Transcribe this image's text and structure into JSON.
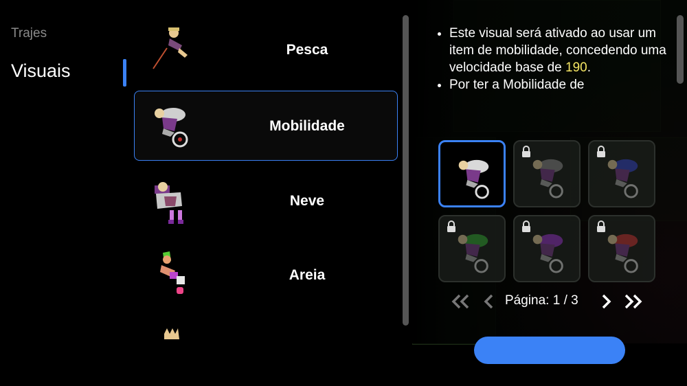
{
  "sidebar": {
    "heading": "Trajes",
    "items": [
      {
        "label": "Visuais",
        "selected": true
      }
    ]
  },
  "outfits": [
    {
      "label": "Pesca",
      "selected": false,
      "icon": "fishing-character-icon"
    },
    {
      "label": "Mobilidade",
      "selected": true,
      "icon": "bike-character-icon"
    },
    {
      "label": "Neve",
      "selected": false,
      "icon": "snow-character-icon"
    },
    {
      "label": "Areia",
      "selected": false,
      "icon": "sand-character-icon"
    },
    {
      "label": "",
      "selected": false,
      "icon": "partial-character-icon"
    }
  ],
  "description": {
    "line1_part1": "Este visual será ativado ao usar um item de mobilidade, concedendo uma velocidade base de ",
    "speed": "190",
    "line1_part2": ".",
    "line2": "Por ter a Mobilidade de"
  },
  "variants": [
    {
      "locked": false,
      "selected": true,
      "accent": "#d9d9d9"
    },
    {
      "locked": true,
      "selected": false,
      "accent": "#8a8a8a"
    },
    {
      "locked": true,
      "selected": false,
      "accent": "#3344cc"
    },
    {
      "locked": true,
      "selected": false,
      "accent": "#33aa33"
    },
    {
      "locked": true,
      "selected": false,
      "accent": "#9933cc"
    },
    {
      "locked": true,
      "selected": false,
      "accent": "#cc3333"
    }
  ],
  "pagination": {
    "label": "Página:",
    "current": "1",
    "separator": "/",
    "total": "3",
    "text": "Página: 1 / 3"
  },
  "colors": {
    "accent": "#3b82f6",
    "highlight": "#f5e663"
  }
}
